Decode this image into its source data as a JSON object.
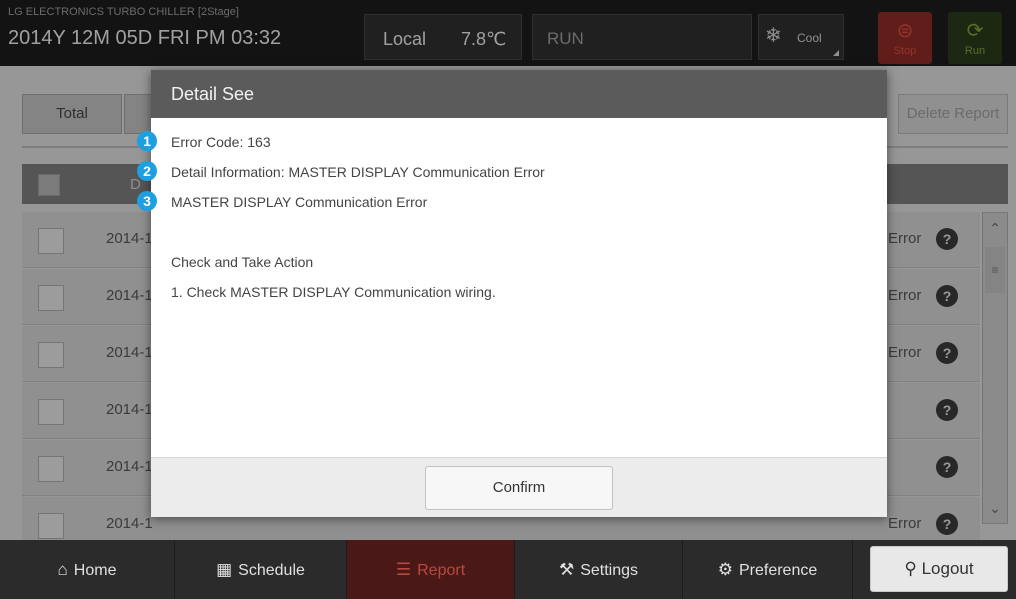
{
  "header": {
    "brand": "LG ELECTRONICS TURBO CHILLER [2Stage]",
    "datetime": "2014Y 12M 05D  FRI PM 03:32",
    "local_label": "Local",
    "temperature": "7.8℃",
    "status": "RUN",
    "mode": "Cool",
    "stop_label": "Stop",
    "run_label": "Run"
  },
  "background": {
    "filter_total": "Total",
    "delete_report": "Delete Report",
    "col_date": "D",
    "rows": [
      {
        "date": "2014-1",
        "error": "Error"
      },
      {
        "date": "2014-1",
        "error": "Error"
      },
      {
        "date": "2014-1",
        "error": "Error"
      },
      {
        "date": "2014-1",
        "error": ""
      },
      {
        "date": "2014-1",
        "error": ""
      },
      {
        "date": "2014-1",
        "error": "Error"
      }
    ],
    "help_glyph": "?"
  },
  "dialog": {
    "title": "Detail See",
    "error_code": "Error Code: 163",
    "detail_information": "Detail Information: MASTER  DISPLAY Communication Error",
    "error_name": "MASTER  DISPLAY Communication Error",
    "action_heading": "Check and Take Action",
    "action_1": "1. Check MASTER  DISPLAY Communication wiring.",
    "confirm_label": "Confirm"
  },
  "markers": [
    "1",
    "2",
    "3"
  ],
  "nav": {
    "home": "Home",
    "schedule": "Schedule",
    "report": "Report",
    "settings": "Settings",
    "preference": "Preference",
    "logout": "Logout"
  },
  "colors": {
    "marker": "#1e9fe0",
    "active_tab": "#b9493f",
    "stop": "#d84a40",
    "run": "#7fa03a"
  }
}
